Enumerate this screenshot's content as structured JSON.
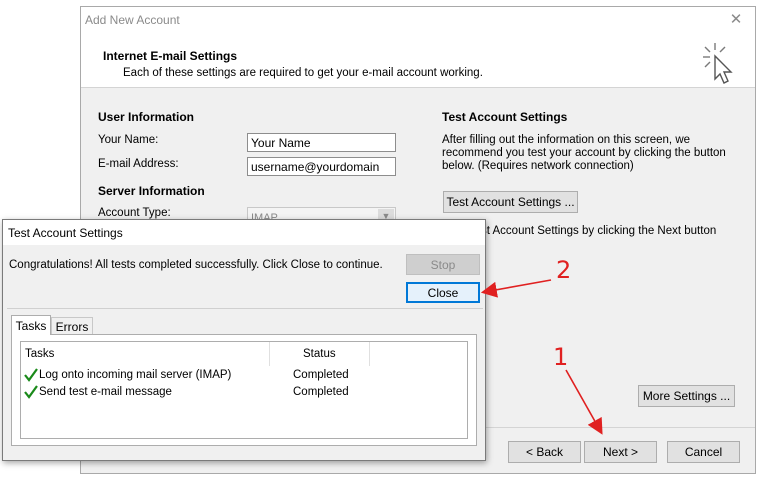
{
  "main": {
    "title": "Add New Account",
    "header_title": "Internet E-mail Settings",
    "header_sub": "Each of these settings are required to get your e-mail account working.",
    "user_info_title": "User Information",
    "your_name_label": "Your Name:",
    "your_name_value": "Your Name",
    "email_label": "E-mail Address:",
    "email_value": "username@yourdomain",
    "server_info_title": "Server Information",
    "account_type_label": "Account Type:",
    "account_type_value": "IMAP",
    "test_title": "Test Account Settings",
    "test_desc_1": "After filling out the information on this screen, we",
    "test_desc_2": "recommend you test your account by clicking the button",
    "test_desc_3": "below. (Requires network connection)",
    "test_button": "Test Account Settings ...",
    "test_next_text": "st Account Settings by clicking the Next button",
    "more_settings_button": "More Settings ...",
    "back_button": "< Back",
    "next_button": "Next >",
    "cancel_button": "Cancel"
  },
  "test_dialog": {
    "title": "Test Account Settings",
    "message": "Congratulations! All tests completed successfully. Click Close to continue.",
    "stop_button": "Stop",
    "close_button": "Close",
    "tabs": [
      "Tasks",
      "Errors"
    ],
    "columns": [
      "Tasks",
      "Status"
    ],
    "rows": [
      {
        "task": "Log onto incoming mail server (IMAP)",
        "status": "Completed"
      },
      {
        "task": "Send test e-mail message",
        "status": "Completed"
      }
    ]
  },
  "annotations": {
    "label_1": "1",
    "label_2": "2",
    "color": "#e02020"
  }
}
